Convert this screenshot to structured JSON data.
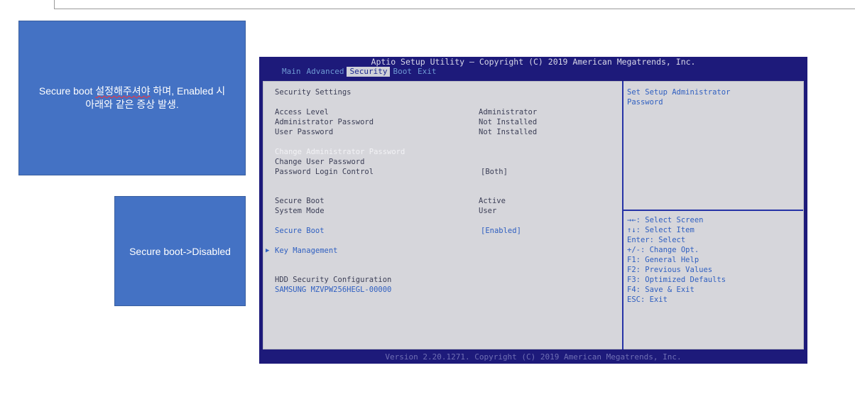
{
  "notes": {
    "note1_text": "Secure boot 설정해주셔야 하며, Enabled 시\n아래와 같은 증상 발생.",
    "note2_text": "Secure boot->Disabled"
  },
  "bios": {
    "title": "Aptio Setup Utility – Copyright (C) 2019 American Megatrends, Inc.",
    "tabs": [
      "Main",
      "Advanced",
      "Security",
      "Boot",
      "Exit"
    ],
    "active_tab": "Security",
    "section_title": "Security Settings",
    "rows": [
      {
        "label": "Access Level",
        "value": "Administrator"
      },
      {
        "label": "Administrator Password",
        "value": "Not Installed"
      },
      {
        "label": "User Password",
        "value": "Not Installed"
      },
      {
        "label": "Change Administrator Password",
        "value": ""
      },
      {
        "label": "Change User Password",
        "value": ""
      },
      {
        "label": "Password Login Control",
        "value": "[Both]"
      },
      {
        "label": "Secure Boot",
        "value": "Active"
      },
      {
        "label": "System Mode",
        "value": "User"
      },
      {
        "label": "Secure Boot",
        "value": "[Enabled]"
      },
      {
        "label": "Key Management",
        "value": ""
      },
      {
        "label": "HDD Security Configuration",
        "value": ""
      },
      {
        "label": "SAMSUNG MZVPW256HEGL-00000",
        "value": ""
      }
    ],
    "help_text": "Set Setup Administrator\nPassword",
    "keys": [
      "→←: Select Screen",
      "↑↓: Select Item",
      "Enter: Select",
      "+/-: Change Opt.",
      "F1: General Help",
      "F2: Previous Values",
      "F3: Optimized Defaults",
      "F4: Save & Exit",
      "ESC: Exit"
    ],
    "footer": "Version 2.20.1271. Copyright (C) 2019 American Megatrends, Inc."
  }
}
